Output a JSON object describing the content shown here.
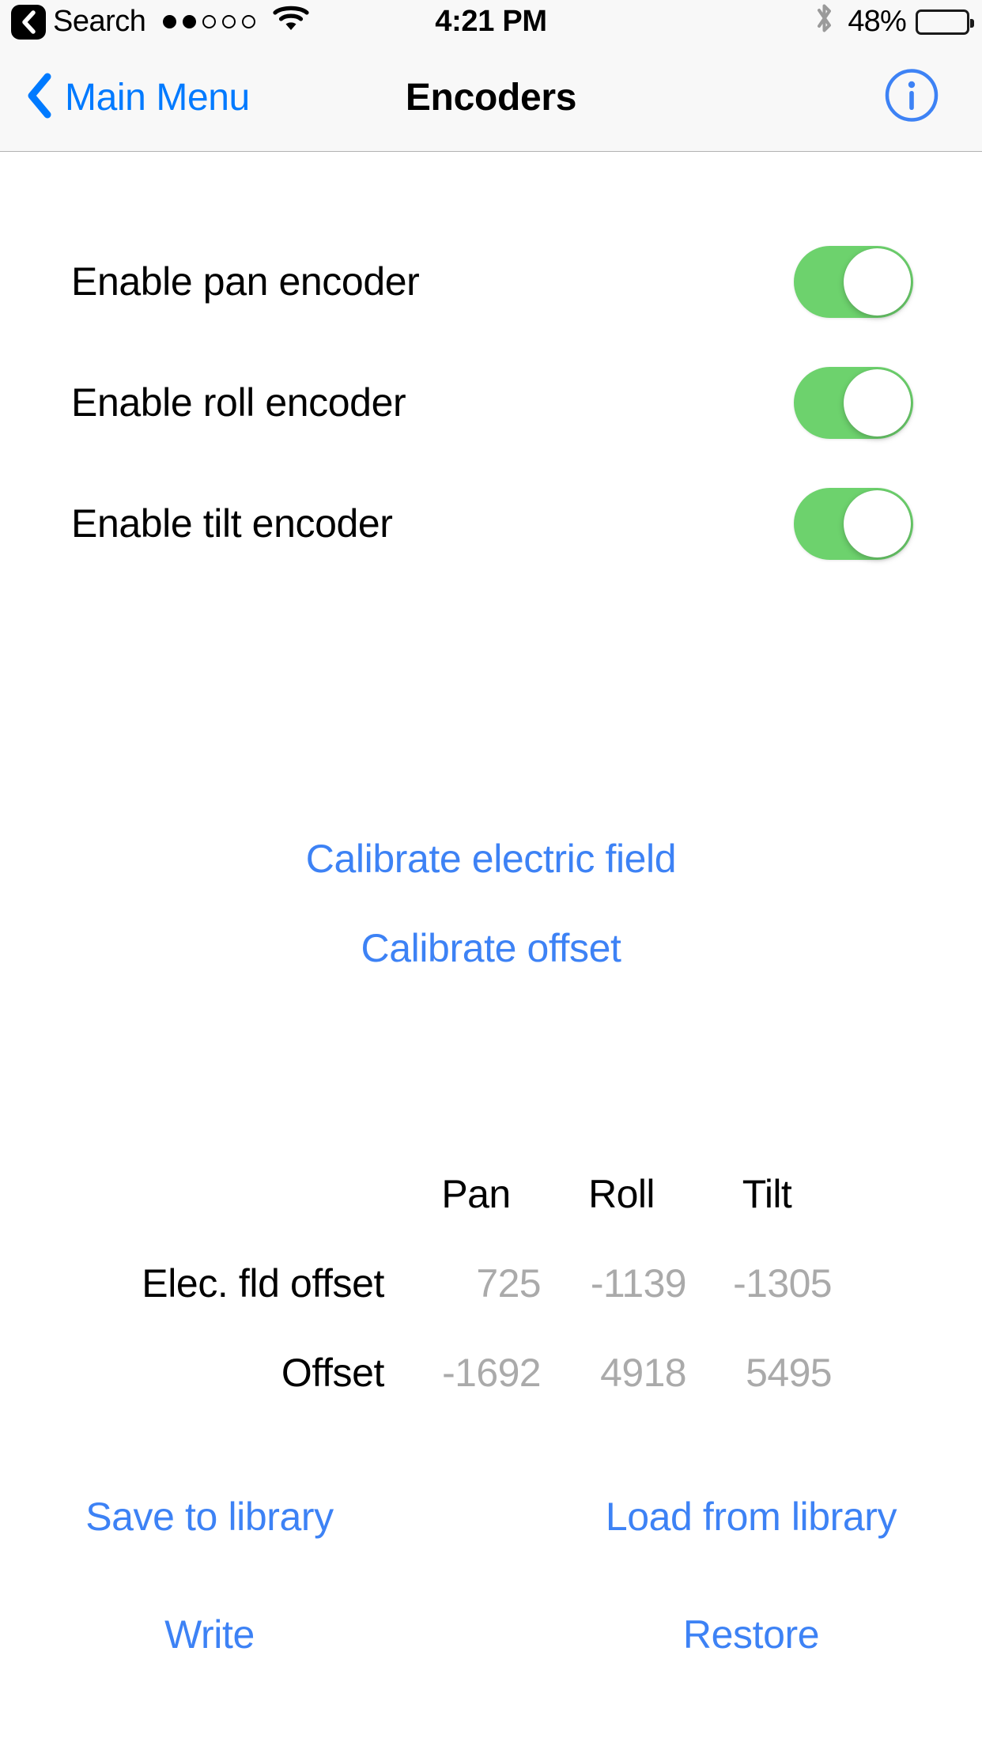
{
  "status_bar": {
    "back_app_label": "Search",
    "back_chip_icon": "chevron-left-icon",
    "signal_dots_filled": 2,
    "signal_dots_total": 5,
    "wifi_icon": "wifi-icon",
    "time": "4:21 PM",
    "bluetooth_icon": "bluetooth-icon",
    "battery_percent_label": "48%",
    "battery_fill_percent": 48
  },
  "nav_bar": {
    "back_label": "Main Menu",
    "back_icon": "chevron-left-icon",
    "title": "Encoders",
    "info_icon": "info-circle-icon",
    "accent_color": "#007aff"
  },
  "toggles": [
    {
      "label": "Enable pan encoder",
      "state": "on"
    },
    {
      "label": "Enable roll encoder",
      "state": "on"
    },
    {
      "label": "Enable tilt encoder",
      "state": "on"
    }
  ],
  "calibration_links": [
    {
      "label": "Calibrate electric field"
    },
    {
      "label": "Calibrate offset"
    }
  ],
  "table": {
    "columns": [
      "Pan",
      "Roll",
      "Tilt"
    ],
    "rows": [
      {
        "label": "Elec. fld offset",
        "values": [
          "725",
          "-1139",
          "-1305"
        ]
      },
      {
        "label": "Offset",
        "values": [
          "-1692",
          "4918",
          "5495"
        ]
      }
    ]
  },
  "actions": {
    "save": "Save to library",
    "load": "Load from library",
    "write": "Write",
    "restore": "Restore"
  },
  "colors": {
    "link_blue": "#3d82f5",
    "switch_on_green": "#6dd26d",
    "value_gray": "#aaaaaa",
    "nav_background": "#f8f8f8"
  }
}
